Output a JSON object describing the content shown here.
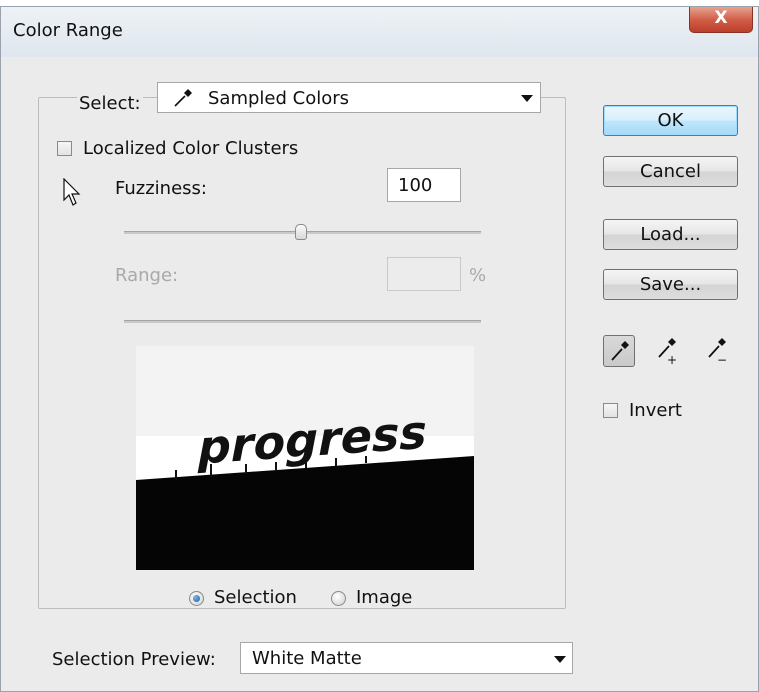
{
  "window": {
    "title": "Color Range",
    "close_label": "X"
  },
  "select": {
    "label": "Select:",
    "value": "Sampled Colors",
    "icon": "eyedropper-icon"
  },
  "localized_clusters": {
    "label": "Localized Color Clusters",
    "checked": false
  },
  "fuzziness": {
    "label": "Fuzziness:",
    "value": "100",
    "slider_fraction": 0.5
  },
  "range": {
    "label": "Range:",
    "value": "",
    "unit": "%",
    "enabled": false
  },
  "preview": {
    "image_text": "progress"
  },
  "view_mode": {
    "options": [
      "Selection",
      "Image"
    ],
    "selected": "Selection"
  },
  "buttons": {
    "ok": "OK",
    "cancel": "Cancel",
    "load": "Load...",
    "save": "Save..."
  },
  "eyedroppers": [
    "eyedropper-icon",
    "eyedropper-plus-icon",
    "eyedropper-minus-icon"
  ],
  "invert": {
    "label": "Invert",
    "checked": false
  },
  "selection_preview": {
    "label": "Selection Preview:",
    "value": "White Matte"
  }
}
